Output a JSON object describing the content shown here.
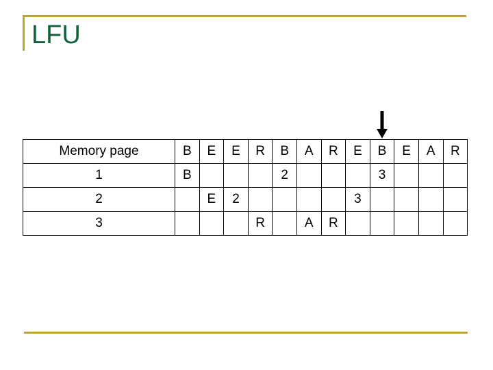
{
  "slide": {
    "title": "LFU",
    "title_color": "#11613b",
    "accent_color": "#bfa434"
  },
  "pointer": {
    "icon": "arrow-down-icon",
    "target_column_index": 8,
    "target_reference": "B",
    "color": "#000000"
  },
  "table": {
    "header": {
      "label": "Memory page",
      "references": [
        "B",
        "E",
        "E",
        "R",
        "B",
        "A",
        "R",
        "E",
        "B",
        "E",
        "A",
        "R"
      ]
    },
    "colors": {
      "page_letter": "#cc99dd",
      "frequency_count": "#a81f1f",
      "border": "#000000"
    },
    "rows": [
      {
        "label": "1",
        "cells": [
          {
            "value": "B",
            "kind": "page"
          },
          {
            "value": "",
            "kind": "empty"
          },
          {
            "value": "",
            "kind": "empty"
          },
          {
            "value": "",
            "kind": "empty"
          },
          {
            "value": "2",
            "kind": "count"
          },
          {
            "value": "",
            "kind": "empty"
          },
          {
            "value": "",
            "kind": "empty"
          },
          {
            "value": "",
            "kind": "empty"
          },
          {
            "value": "3",
            "kind": "count"
          },
          {
            "value": "",
            "kind": "empty"
          },
          {
            "value": "",
            "kind": "empty"
          },
          {
            "value": "",
            "kind": "empty"
          }
        ]
      },
      {
        "label": "2",
        "cells": [
          {
            "value": "",
            "kind": "empty"
          },
          {
            "value": "E",
            "kind": "page"
          },
          {
            "value": "2",
            "kind": "count"
          },
          {
            "value": "",
            "kind": "empty"
          },
          {
            "value": "",
            "kind": "empty"
          },
          {
            "value": "",
            "kind": "empty"
          },
          {
            "value": "",
            "kind": "empty"
          },
          {
            "value": "3",
            "kind": "count"
          },
          {
            "value": "",
            "kind": "empty"
          },
          {
            "value": "",
            "kind": "empty"
          },
          {
            "value": "",
            "kind": "empty"
          },
          {
            "value": "",
            "kind": "empty"
          }
        ]
      },
      {
        "label": "3",
        "cells": [
          {
            "value": "",
            "kind": "empty"
          },
          {
            "value": "",
            "kind": "empty"
          },
          {
            "value": "",
            "kind": "empty"
          },
          {
            "value": "R",
            "kind": "page"
          },
          {
            "value": "",
            "kind": "empty"
          },
          {
            "value": "A",
            "kind": "page"
          },
          {
            "value": "R",
            "kind": "page"
          },
          {
            "value": "",
            "kind": "empty"
          },
          {
            "value": "",
            "kind": "empty"
          },
          {
            "value": "",
            "kind": "empty"
          },
          {
            "value": "",
            "kind": "empty"
          },
          {
            "value": "",
            "kind": "empty"
          }
        ]
      }
    ]
  }
}
